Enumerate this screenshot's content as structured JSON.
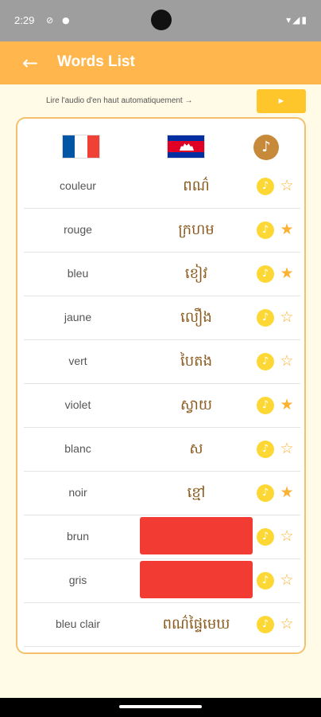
{
  "status": {
    "time": "2:29",
    "icons": [
      "do-not-disturb-icon",
      "notification-icon",
      "wifi-icon",
      "signal-icon",
      "battery-icon"
    ]
  },
  "app_bar": {
    "title": "Words List",
    "back_icon": "arrow-left-icon"
  },
  "autoplay": {
    "text": "Lire l'audio d'en haut automatiquement →",
    "button_label": "►"
  },
  "header": {
    "flag_left": "france-flag-icon",
    "flag_right": "cambodia-flag-icon",
    "music_icon": "♪"
  },
  "colors": {
    "accent": "#ffb74d",
    "button": "#ffc62b",
    "border": "#f5c06b",
    "star": "#f9b233",
    "play": "#fdd835",
    "khmer_text": "#8a5a1e",
    "hidden_block": "#f23b32"
  },
  "words": [
    {
      "fr": "couleur",
      "kh": "ពណ៌",
      "favorite": false,
      "hidden": false
    },
    {
      "fr": "rouge",
      "kh": "ក្រហម",
      "favorite": true,
      "hidden": false
    },
    {
      "fr": "bleu",
      "kh": "ខៀវ",
      "favorite": true,
      "hidden": false
    },
    {
      "fr": "jaune",
      "kh": "លឿង",
      "favorite": false,
      "hidden": false
    },
    {
      "fr": "vert",
      "kh": "បៃតង",
      "favorite": false,
      "hidden": false
    },
    {
      "fr": "violet",
      "kh": "ស្វាយ",
      "favorite": true,
      "hidden": false
    },
    {
      "fr": "blanc",
      "kh": "ស",
      "favorite": false,
      "hidden": false
    },
    {
      "fr": "noir",
      "kh": "ខ្មៅ",
      "favorite": true,
      "hidden": false
    },
    {
      "fr": "brun",
      "kh": "",
      "favorite": false,
      "hidden": true
    },
    {
      "fr": "gris",
      "kh": "",
      "favorite": false,
      "hidden": true
    },
    {
      "fr": "bleu clair",
      "kh": "ពណ៌ផ្ទៃមេឃ",
      "favorite": false,
      "hidden": false
    }
  ],
  "glyphs": {
    "star_on": "★",
    "star_off": "☆",
    "play": "♪"
  }
}
